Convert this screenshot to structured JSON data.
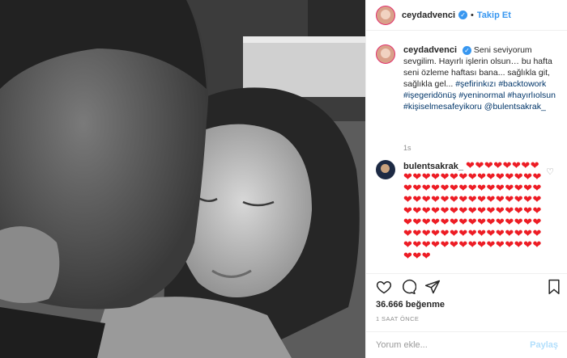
{
  "post": {
    "username": "ceydadvenci",
    "follow_label": "Takip Et",
    "dot": "•",
    "caption_text": "Seni seviyorum sevgilim. Hayırlı işlerin olsun… bu hafta seni özleme haftası bana... sağlıkla git, sağlıkla gel...",
    "hashtags": [
      "#şefirinkızı",
      "#backtowork",
      "#işegeridönüş",
      "#yeninormal",
      "#hayırlıolsun",
      "#kişiselmesafeyikoru",
      "@bulentsakrak_"
    ],
    "caption_time": "1s"
  },
  "comment": {
    "username": "bulentsakrak_",
    "hearts": "❤❤❤❤❤❤❤❤❤❤❤❤❤❤❤❤❤❤❤❤❤❤❤❤❤❤❤❤❤❤❤❤❤❤❤❤❤❤❤❤❤❤❤❤❤❤❤❤❤❤❤❤❤❤❤❤❤❤❤❤❤❤❤❤❤❤❤❤❤❤❤❤❤❤❤❤❤❤❤❤❤❤❤❤❤❤❤❤❤❤❤❤❤❤❤❤❤❤❤❤❤❤❤❤❤❤❤❤❤❤❤❤❤❤❤❤"
  },
  "footer": {
    "likes": "36.666 beğenme",
    "time_ago": "1 SAAT ÖNCE",
    "comment_placeholder": "Yorum ekle...",
    "post_label": "Paylaş"
  },
  "icons": [
    "heart-icon",
    "comment-icon",
    "share-icon",
    "bookmark-icon",
    "verified-icon"
  ],
  "colors": {
    "accent": "#3897f0",
    "heart": "#ed1c24"
  }
}
